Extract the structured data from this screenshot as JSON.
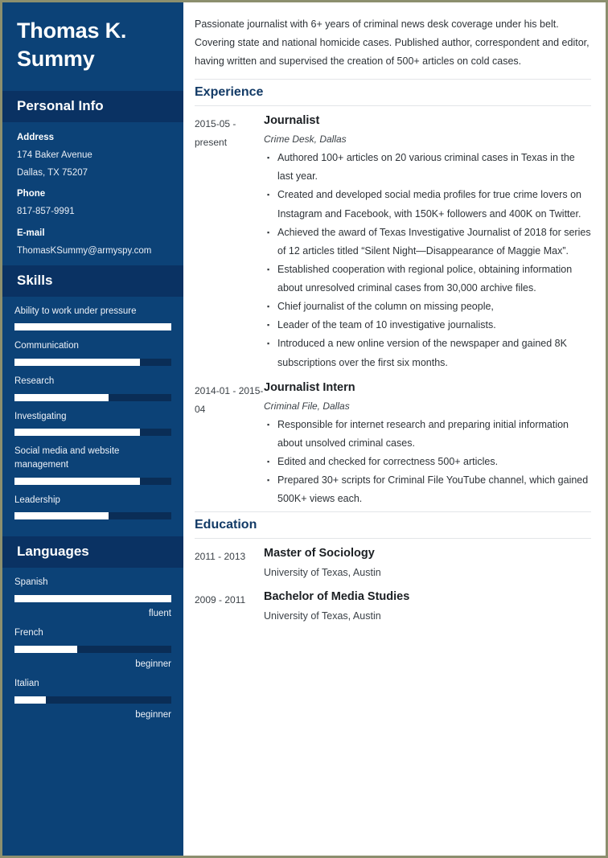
{
  "theme": {
    "sidebar_bg": "#0c4277",
    "band_bg": "#0a3263",
    "bar_track": "#0a2d56",
    "bar_fill": "#ffffff",
    "heading_color": "#123a66",
    "page_border": "#8c8f6e"
  },
  "sidebar": {
    "name": "Thomas K. Summy",
    "personal_info": {
      "heading": "Personal Info",
      "fields": [
        {
          "label": "Address",
          "values": [
            "174 Baker Avenue",
            "Dallas, TX 75207"
          ]
        },
        {
          "label": "Phone",
          "values": [
            "817-857-9991"
          ]
        },
        {
          "label": "E-mail",
          "values": [
            "ThomasKSummy@armyspy.com"
          ]
        }
      ]
    },
    "skills": {
      "heading": "Skills",
      "items": [
        {
          "name": "Ability to work under pressure",
          "level": 100
        },
        {
          "name": "Communication",
          "level": 80
        },
        {
          "name": "Research",
          "level": 60
        },
        {
          "name": "Investigating",
          "level": 80
        },
        {
          "name": "Social media and website management",
          "level": 80
        },
        {
          "name": "Leadership",
          "level": 60
        }
      ]
    },
    "languages": {
      "heading": "Languages",
      "items": [
        {
          "name": "Spanish",
          "level": 100,
          "proficiency": "fluent"
        },
        {
          "name": "French",
          "level": 40,
          "proficiency": "beginner"
        },
        {
          "name": "Italian",
          "level": 20,
          "proficiency": "beginner"
        }
      ]
    }
  },
  "main": {
    "summary": "Passionate journalist with 6+ years of criminal news desk coverage under his belt. Covering state and national homicide cases. Published author, correspondent and editor, having written and supervised the creation of 500+ articles on cold cases.",
    "experience": {
      "heading": "Experience",
      "entries": [
        {
          "date": "2015-05 - present",
          "title": "Journalist",
          "subtitle": "Crime Desk, Dallas",
          "bullets": [
            "Authored 100+ articles on 20 various criminal cases in Texas in the last year.",
            "Created and developed social media profiles for true crime lovers on Instagram and Facebook, with 150K+ followers and 400K on Twitter.",
            "Achieved the award of Texas Investigative Journalist of 2018 for series of 12 articles titled “Silent Night—Disappearance of Maggie Max”.",
            "Established cooperation with regional police, obtaining information about unresolved criminal cases from 30,000 archive files.",
            "Chief journalist of the column on missing people,",
            "Leader of the team of 10 investigative journalists.",
            "Introduced a new online version of the newspaper and gained 8K subscriptions over the first six months."
          ]
        },
        {
          "date": "2014-01 - 2015-04",
          "title": "Journalist Intern",
          "subtitle": "Criminal File, Dallas",
          "bullets": [
            "Responsible for internet research and preparing initial information about unsolved criminal cases.",
            "Edited and checked for correctness 500+ articles.",
            "Prepared 30+ scripts for Criminal File YouTube channel, which gained 500K+ views each."
          ]
        }
      ]
    },
    "education": {
      "heading": "Education",
      "entries": [
        {
          "date": "2011 - 2013",
          "title": "Master of Sociology",
          "school": "University of Texas, Austin"
        },
        {
          "date": "2009 - 2011",
          "title": "Bachelor of Media Studies",
          "school": "University of Texas, Austin"
        }
      ]
    }
  }
}
